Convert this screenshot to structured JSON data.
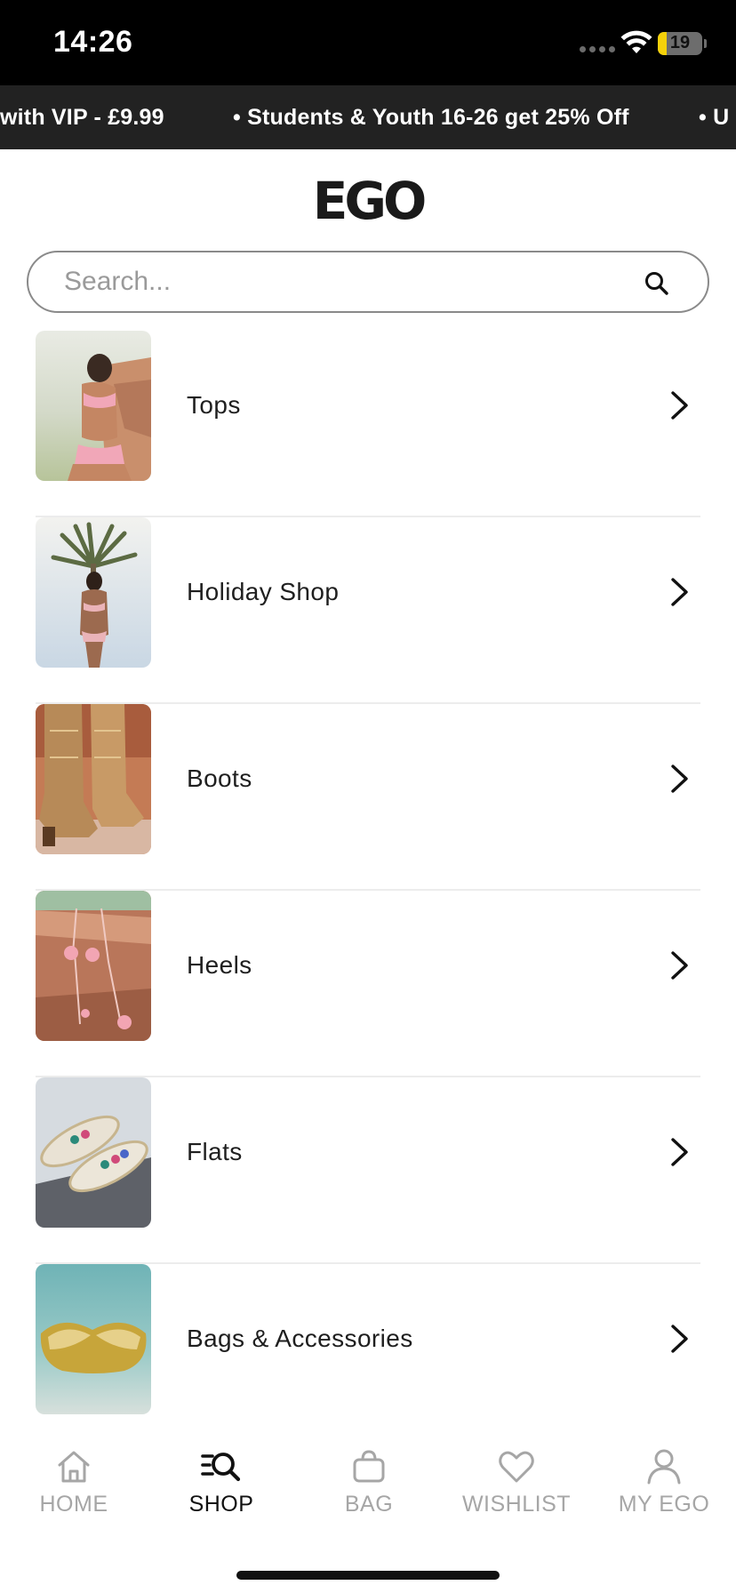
{
  "status_bar": {
    "time": "14:26",
    "battery": "19",
    "battery_level": 0.19
  },
  "promo": {
    "items": [
      "with VIP - £9.99",
      "• Students & Youth 16-26 get 25% Off",
      "• U"
    ]
  },
  "header": {
    "logo": "EGO"
  },
  "search": {
    "placeholder": "Search...",
    "icon": "search-icon"
  },
  "categories": [
    {
      "label": "Tops",
      "icon": "chevron-right-icon"
    },
    {
      "label": "Holiday Shop",
      "icon": "chevron-right-icon"
    },
    {
      "label": "Boots",
      "icon": "chevron-right-icon"
    },
    {
      "label": "Heels",
      "icon": "chevron-right-icon"
    },
    {
      "label": "Flats",
      "icon": "chevron-right-icon"
    },
    {
      "label": "Bags & Accessories",
      "icon": "chevron-right-icon"
    }
  ],
  "tab_bar": {
    "tabs": [
      {
        "label": "HOME",
        "icon": "home-icon",
        "active": false
      },
      {
        "label": "SHOP",
        "icon": "shop-search-icon",
        "active": true
      },
      {
        "label": "BAG",
        "icon": "bag-icon",
        "active": false
      },
      {
        "label": "WISHLIST",
        "icon": "heart-icon",
        "active": false
      },
      {
        "label": "MY EGO",
        "icon": "user-icon",
        "active": false
      }
    ]
  },
  "colors": {
    "status_bar_bg": "#000000",
    "promo_bg": "#222222",
    "text": "#1a1a1a",
    "inactive_tab": "#a6a6a6",
    "battery_low": "#f5d10a"
  }
}
